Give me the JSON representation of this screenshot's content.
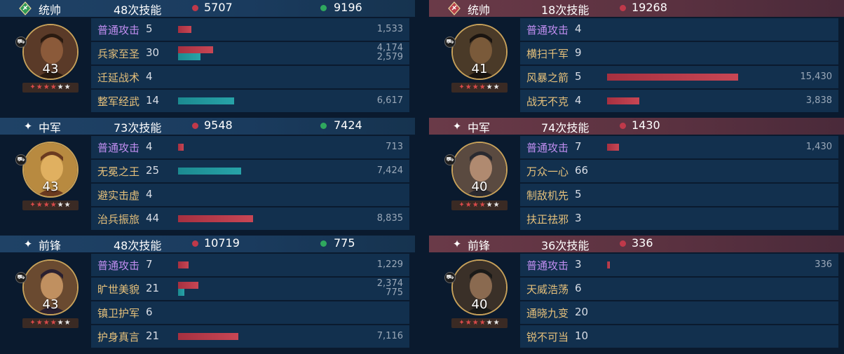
{
  "left": {
    "sections": [
      {
        "role": "统帅",
        "role_icon": "commander-badge-icon",
        "skills_count": "48次技能",
        "damage": "5707",
        "heal": "9196",
        "level": "43",
        "rows": [
          {
            "name": "普通攻击",
            "count": "5",
            "bars": [
              {
                "type": "red",
                "pct": 0.045
              }
            ],
            "values": [
              "1,533"
            ]
          },
          {
            "name": "兵家至圣",
            "count": "30",
            "bars": [
              {
                "type": "red",
                "pct": 0.12
              },
              {
                "type": "teal",
                "pct": 0.075
              }
            ],
            "values": [
              "4,174",
              "2,579"
            ]
          },
          {
            "name": "迁延战术",
            "count": "4",
            "bars": [],
            "values": []
          },
          {
            "name": "整军经武",
            "count": "14",
            "bars": [
              {
                "type": "teal",
                "pct": 0.19
              }
            ],
            "values": [
              "6,617"
            ]
          }
        ]
      },
      {
        "role": "中军",
        "role_icon": "star-icon",
        "skills_count": "73次技能",
        "damage": "9548",
        "heal": "7424",
        "level": "43",
        "rows": [
          {
            "name": "普通攻击",
            "count": "4",
            "bars": [
              {
                "type": "red",
                "pct": 0.02
              }
            ],
            "values": [
              "713"
            ]
          },
          {
            "name": "无冕之王",
            "count": "25",
            "bars": [
              {
                "type": "teal",
                "pct": 0.215
              }
            ],
            "values": [
              "7,424"
            ]
          },
          {
            "name": "避实击虚",
            "count": "4",
            "bars": [],
            "values": []
          },
          {
            "name": "治兵振旅",
            "count": "44",
            "bars": [
              {
                "type": "red",
                "pct": 0.255
              }
            ],
            "values": [
              "8,835"
            ]
          }
        ]
      },
      {
        "role": "前锋",
        "role_icon": "star-icon",
        "skills_count": "48次技能",
        "damage": "10719",
        "heal": "775",
        "level": "43",
        "rows": [
          {
            "name": "普通攻击",
            "count": "7",
            "bars": [
              {
                "type": "red",
                "pct": 0.035
              }
            ],
            "values": [
              "1,229"
            ]
          },
          {
            "name": "旷世美貌",
            "count": "21",
            "bars": [
              {
                "type": "red",
                "pct": 0.068
              },
              {
                "type": "teal",
                "pct": 0.022
              }
            ],
            "values": [
              "2,374",
              "775"
            ]
          },
          {
            "name": "镇卫护军",
            "count": "6",
            "bars": [],
            "values": []
          },
          {
            "name": "护身真言",
            "count": "21",
            "bars": [
              {
                "type": "red",
                "pct": 0.205
              }
            ],
            "values": [
              "7,116"
            ]
          }
        ]
      }
    ]
  },
  "right": {
    "sections": [
      {
        "role": "统帅",
        "role_icon": "commander-sword-icon",
        "skills_count": "18次技能",
        "damage": "19268",
        "level": "41",
        "rows": [
          {
            "name": "普通攻击",
            "count": "4",
            "bars": [],
            "values": []
          },
          {
            "name": "横扫千军",
            "count": "9",
            "bars": [],
            "values": []
          },
          {
            "name": "风暴之箭",
            "count": "5",
            "bars": [
              {
                "type": "red",
                "pct": 0.445
              }
            ],
            "values": [
              "15,430"
            ]
          },
          {
            "name": "战无不克",
            "count": "4",
            "bars": [
              {
                "type": "red",
                "pct": 0.11
              }
            ],
            "values": [
              "3,838"
            ]
          }
        ]
      },
      {
        "role": "中军",
        "role_icon": "star-icon",
        "skills_count": "74次技能",
        "damage": "1430",
        "level": "40",
        "rows": [
          {
            "name": "普通攻击",
            "count": "7",
            "bars": [
              {
                "type": "red",
                "pct": 0.041
              }
            ],
            "values": [
              "1,430"
            ]
          },
          {
            "name": "万众一心",
            "count": "66",
            "bars": [],
            "values": []
          },
          {
            "name": "制敌机先",
            "count": "5",
            "bars": [],
            "values": []
          },
          {
            "name": "扶正祛邪",
            "count": "3",
            "bars": [],
            "values": []
          }
        ]
      },
      {
        "role": "前锋",
        "role_icon": "star-icon",
        "skills_count": "36次技能",
        "damage": "336",
        "level": "40",
        "rows": [
          {
            "name": "普通攻击",
            "count": "3",
            "bars": [
              {
                "type": "red",
                "pct": 0.01
              }
            ],
            "values": [
              "336"
            ]
          },
          {
            "name": "天威浩荡",
            "count": "6",
            "bars": [],
            "values": []
          },
          {
            "name": "通晓九变",
            "count": "20",
            "bars": [],
            "values": []
          },
          {
            "name": "锐不可当",
            "count": "10",
            "bars": [],
            "values": []
          }
        ]
      }
    ]
  },
  "colors": {
    "damage": "#c0394a",
    "heal": "#2fa85e",
    "skill_name": "#e5c07b",
    "normal_attack": "#c08ef0"
  }
}
